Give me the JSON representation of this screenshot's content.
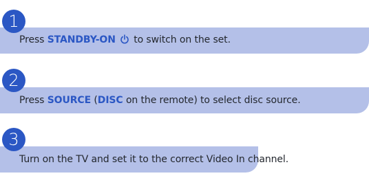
{
  "accent_color": "#2b57c4",
  "bar_color": "#b4c0e8",
  "text_color": "#23272e",
  "steps": [
    {
      "number": "1",
      "parts": [
        {
          "text": "Press ",
          "bold": false
        },
        {
          "text": "STANDBY-ON",
          "bold": true
        },
        {
          "icon": "power-icon"
        },
        {
          "text": "to switch on the set.",
          "bold": false
        }
      ]
    },
    {
      "number": "2",
      "parts": [
        {
          "text": "Press ",
          "bold": false
        },
        {
          "text": "SOURCE",
          "bold": true
        },
        {
          "text": " (",
          "bold": false
        },
        {
          "text": "DISC",
          "bold": true
        },
        {
          "text": " on the remote) to select disc source.",
          "bold": false
        }
      ]
    },
    {
      "number": "3",
      "parts": [
        {
          "text": "Turn on the TV and set it to the correct Video In channel.",
          "bold": false
        }
      ]
    }
  ]
}
